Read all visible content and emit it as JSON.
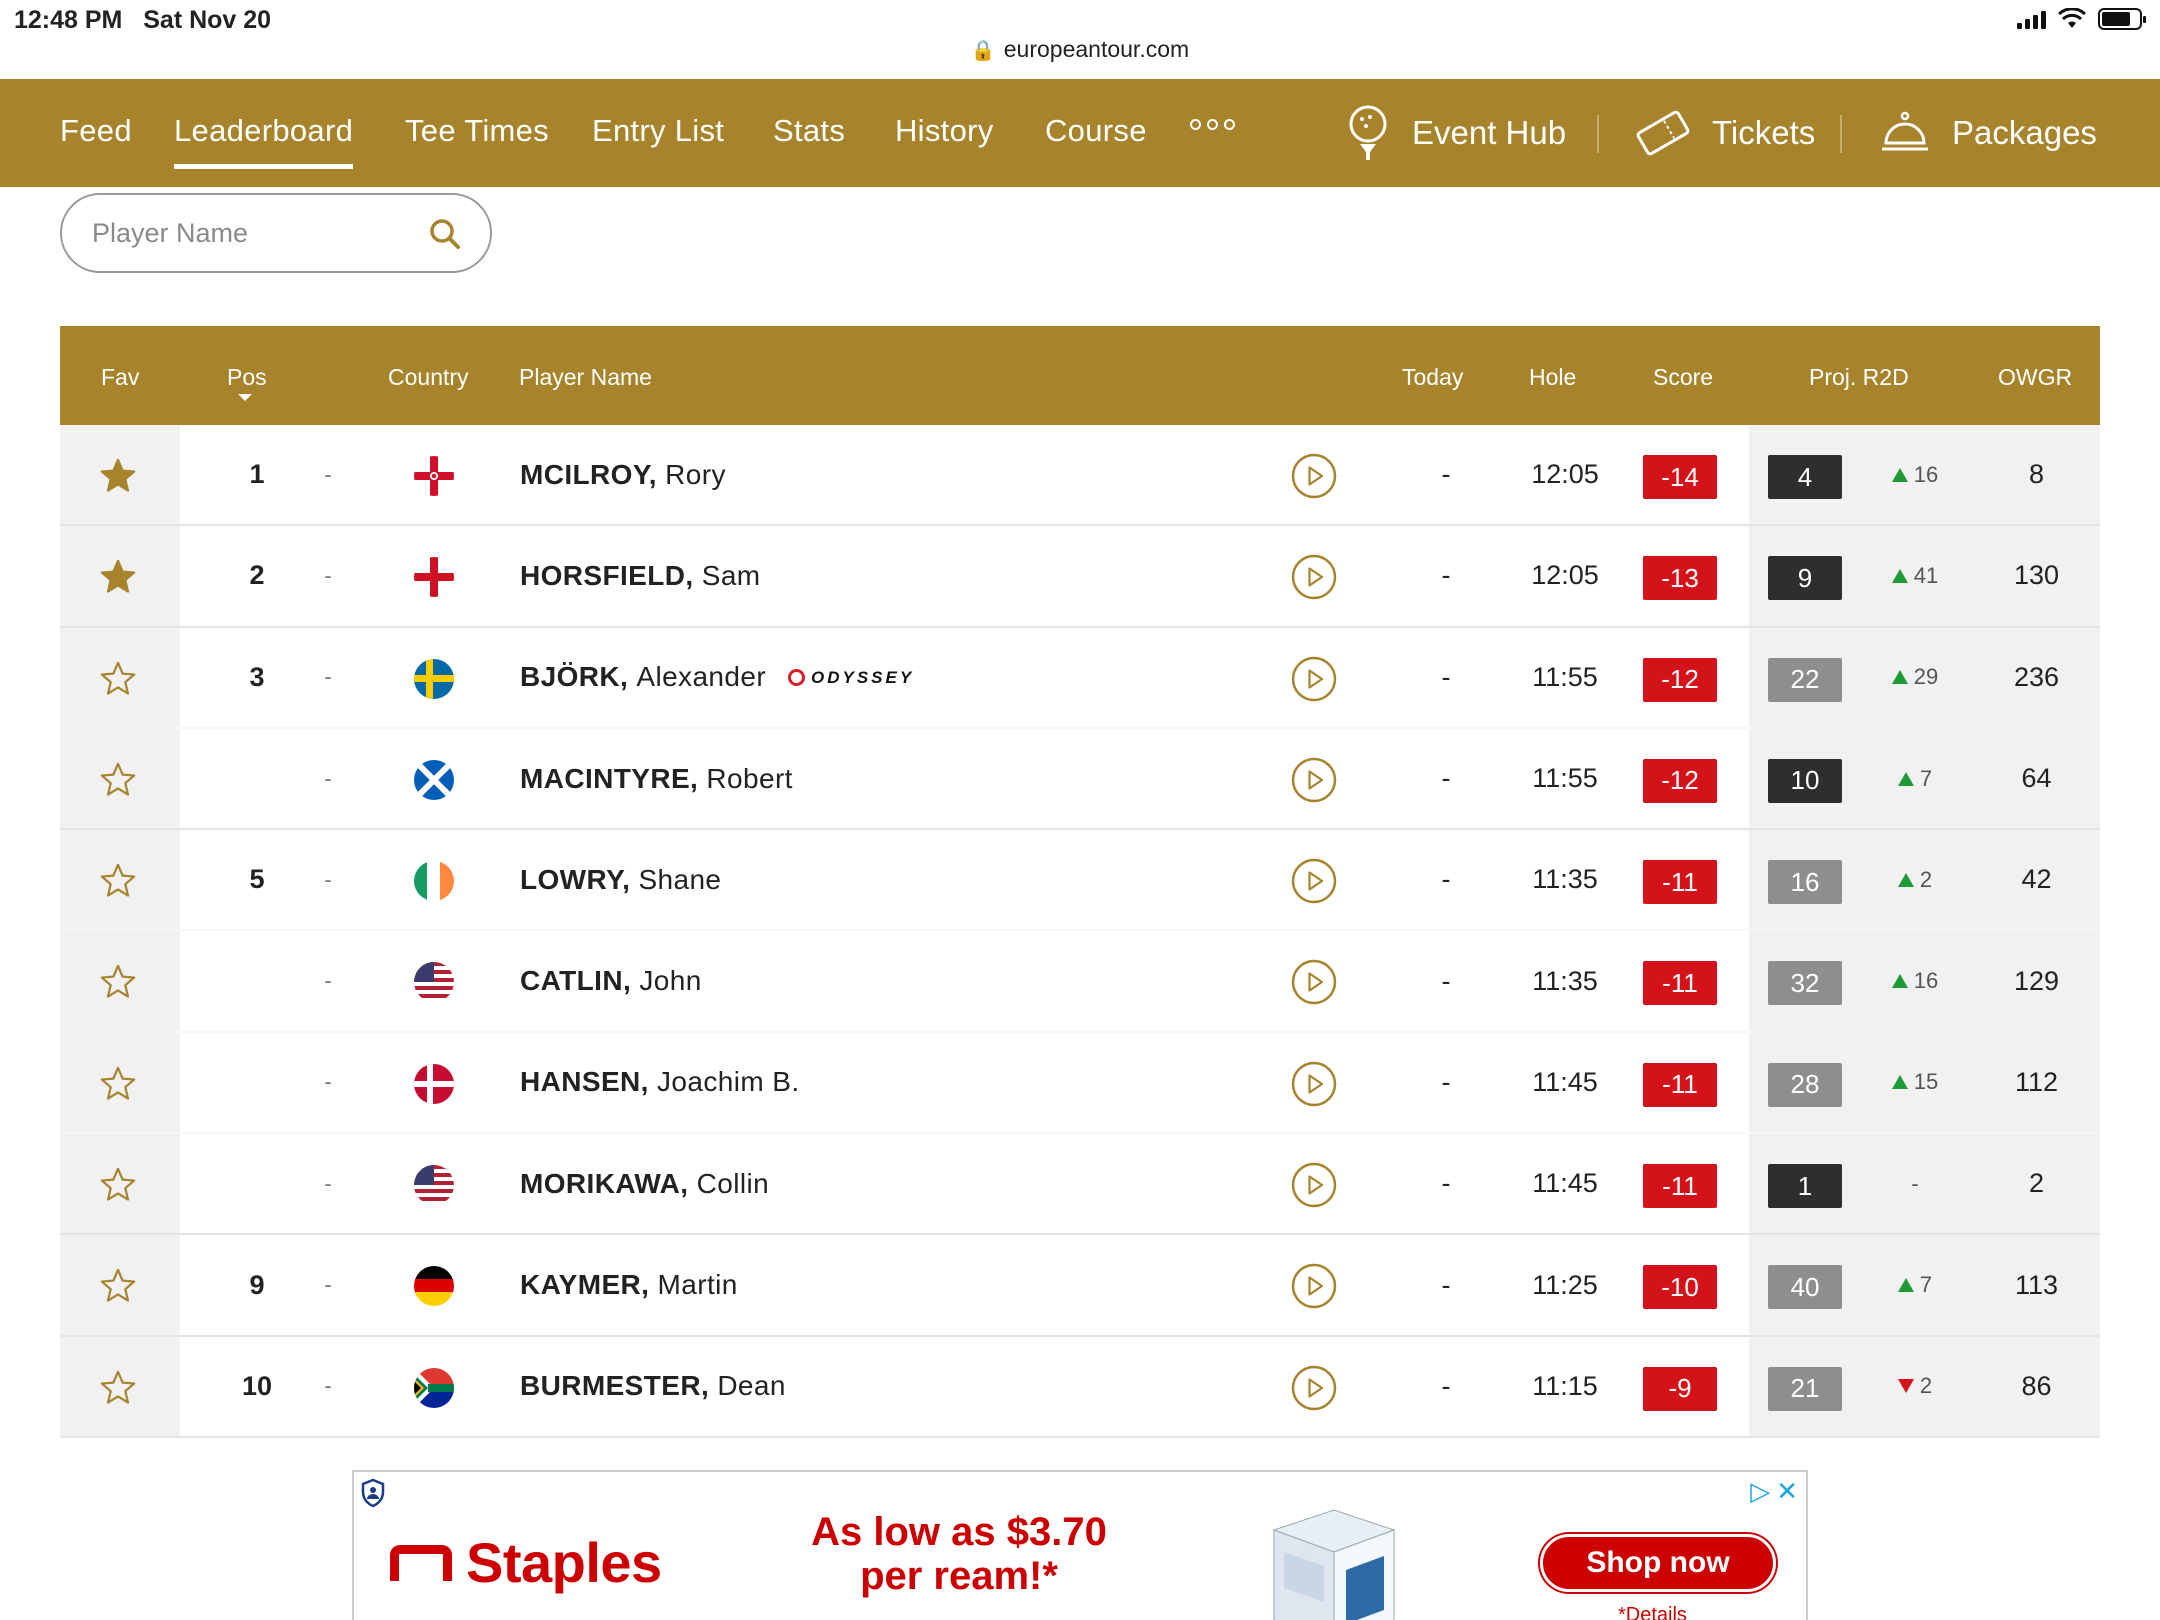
{
  "status_bar": {
    "time": "12:48 PM",
    "date": "Sat Nov 20",
    "url": "europeantour.com"
  },
  "nav": {
    "tabs": [
      "Feed",
      "Leaderboard",
      "Tee Times",
      "Entry List",
      "Stats",
      "History",
      "Course"
    ],
    "active_tab": "Leaderboard",
    "links": {
      "event_hub": "Event Hub",
      "tickets": "Tickets",
      "packages": "Packages"
    }
  },
  "search": {
    "placeholder": "Player Name"
  },
  "table": {
    "headers": {
      "fav": "Fav",
      "pos": "Pos",
      "country": "Country",
      "player": "Player Name",
      "today": "Today",
      "hole": "Hole",
      "score": "Score",
      "proj": "Proj. R2D",
      "owgr": "OWGR"
    },
    "rows": [
      {
        "fav": true,
        "pos": "1",
        "move": "-",
        "country": "Northern Ireland",
        "last": "MCILROY,",
        "first": "Rory",
        "sponsor": "",
        "today": "-",
        "hole": "12:05",
        "score": "-14",
        "proj": "4",
        "proj_style": "dark",
        "dir": "up",
        "delta": "16",
        "owgr": "8"
      },
      {
        "fav": true,
        "pos": "2",
        "move": "-",
        "country": "England",
        "last": "HORSFIELD,",
        "first": "Sam",
        "sponsor": "",
        "today": "-",
        "hole": "12:05",
        "score": "-13",
        "proj": "9",
        "proj_style": "dark",
        "dir": "up",
        "delta": "41",
        "owgr": "130"
      },
      {
        "fav": false,
        "pos": "3",
        "move": "-",
        "country": "Sweden",
        "last": "BJÖRK,",
        "first": "Alexander",
        "sponsor": "ODYSSEY",
        "today": "-",
        "hole": "11:55",
        "score": "-12",
        "proj": "22",
        "proj_style": "grey",
        "dir": "up",
        "delta": "29",
        "owgr": "236"
      },
      {
        "fav": false,
        "pos": "",
        "move": "-",
        "country": "Scotland",
        "last": "MACINTYRE,",
        "first": "Robert",
        "sponsor": "",
        "today": "-",
        "hole": "11:55",
        "score": "-12",
        "proj": "10",
        "proj_style": "dark",
        "dir": "up",
        "delta": "7",
        "owgr": "64"
      },
      {
        "fav": false,
        "pos": "5",
        "move": "-",
        "country": "Ireland",
        "last": "LOWRY,",
        "first": "Shane",
        "sponsor": "",
        "today": "-",
        "hole": "11:35",
        "score": "-11",
        "proj": "16",
        "proj_style": "grey",
        "dir": "up",
        "delta": "2",
        "owgr": "42"
      },
      {
        "fav": false,
        "pos": "",
        "move": "-",
        "country": "United States",
        "last": "CATLIN,",
        "first": "John",
        "sponsor": "",
        "today": "-",
        "hole": "11:35",
        "score": "-11",
        "proj": "32",
        "proj_style": "grey",
        "dir": "up",
        "delta": "16",
        "owgr": "129"
      },
      {
        "fav": false,
        "pos": "",
        "move": "-",
        "country": "Denmark",
        "last": "HANSEN,",
        "first": "Joachim B.",
        "sponsor": "",
        "today": "-",
        "hole": "11:45",
        "score": "-11",
        "proj": "28",
        "proj_style": "grey",
        "dir": "up",
        "delta": "15",
        "owgr": "112"
      },
      {
        "fav": false,
        "pos": "",
        "move": "-",
        "country": "United States",
        "last": "MORIKAWA,",
        "first": "Collin",
        "sponsor": "",
        "today": "-",
        "hole": "11:45",
        "score": "-11",
        "proj": "1",
        "proj_style": "dark",
        "dir": "none",
        "delta": "-",
        "owgr": "2"
      },
      {
        "fav": false,
        "pos": "9",
        "move": "-",
        "country": "Germany",
        "last": "KAYMER,",
        "first": "Martin",
        "sponsor": "",
        "today": "-",
        "hole": "11:25",
        "score": "-10",
        "proj": "40",
        "proj_style": "grey",
        "dir": "up",
        "delta": "7",
        "owgr": "113"
      },
      {
        "fav": false,
        "pos": "10",
        "move": "-",
        "country": "South Africa",
        "last": "BURMESTER,",
        "first": "Dean",
        "sponsor": "",
        "today": "-",
        "hole": "11:15",
        "score": "-9",
        "proj": "21",
        "proj_style": "grey",
        "dir": "down",
        "delta": "2",
        "owgr": "86"
      }
    ]
  },
  "ad": {
    "brand": "Staples",
    "promo_line1": "As low as $3.70",
    "promo_line2": "per ream!*",
    "cta": "Shop now",
    "details": "*Details"
  },
  "colors": {
    "brand_gold": "#a7832c",
    "score_red": "#d41219",
    "proj_dark": "#2e2e2e",
    "proj_grey": "#8e8e8e",
    "up_green": "#1e9a37",
    "down_red": "#d41219"
  }
}
